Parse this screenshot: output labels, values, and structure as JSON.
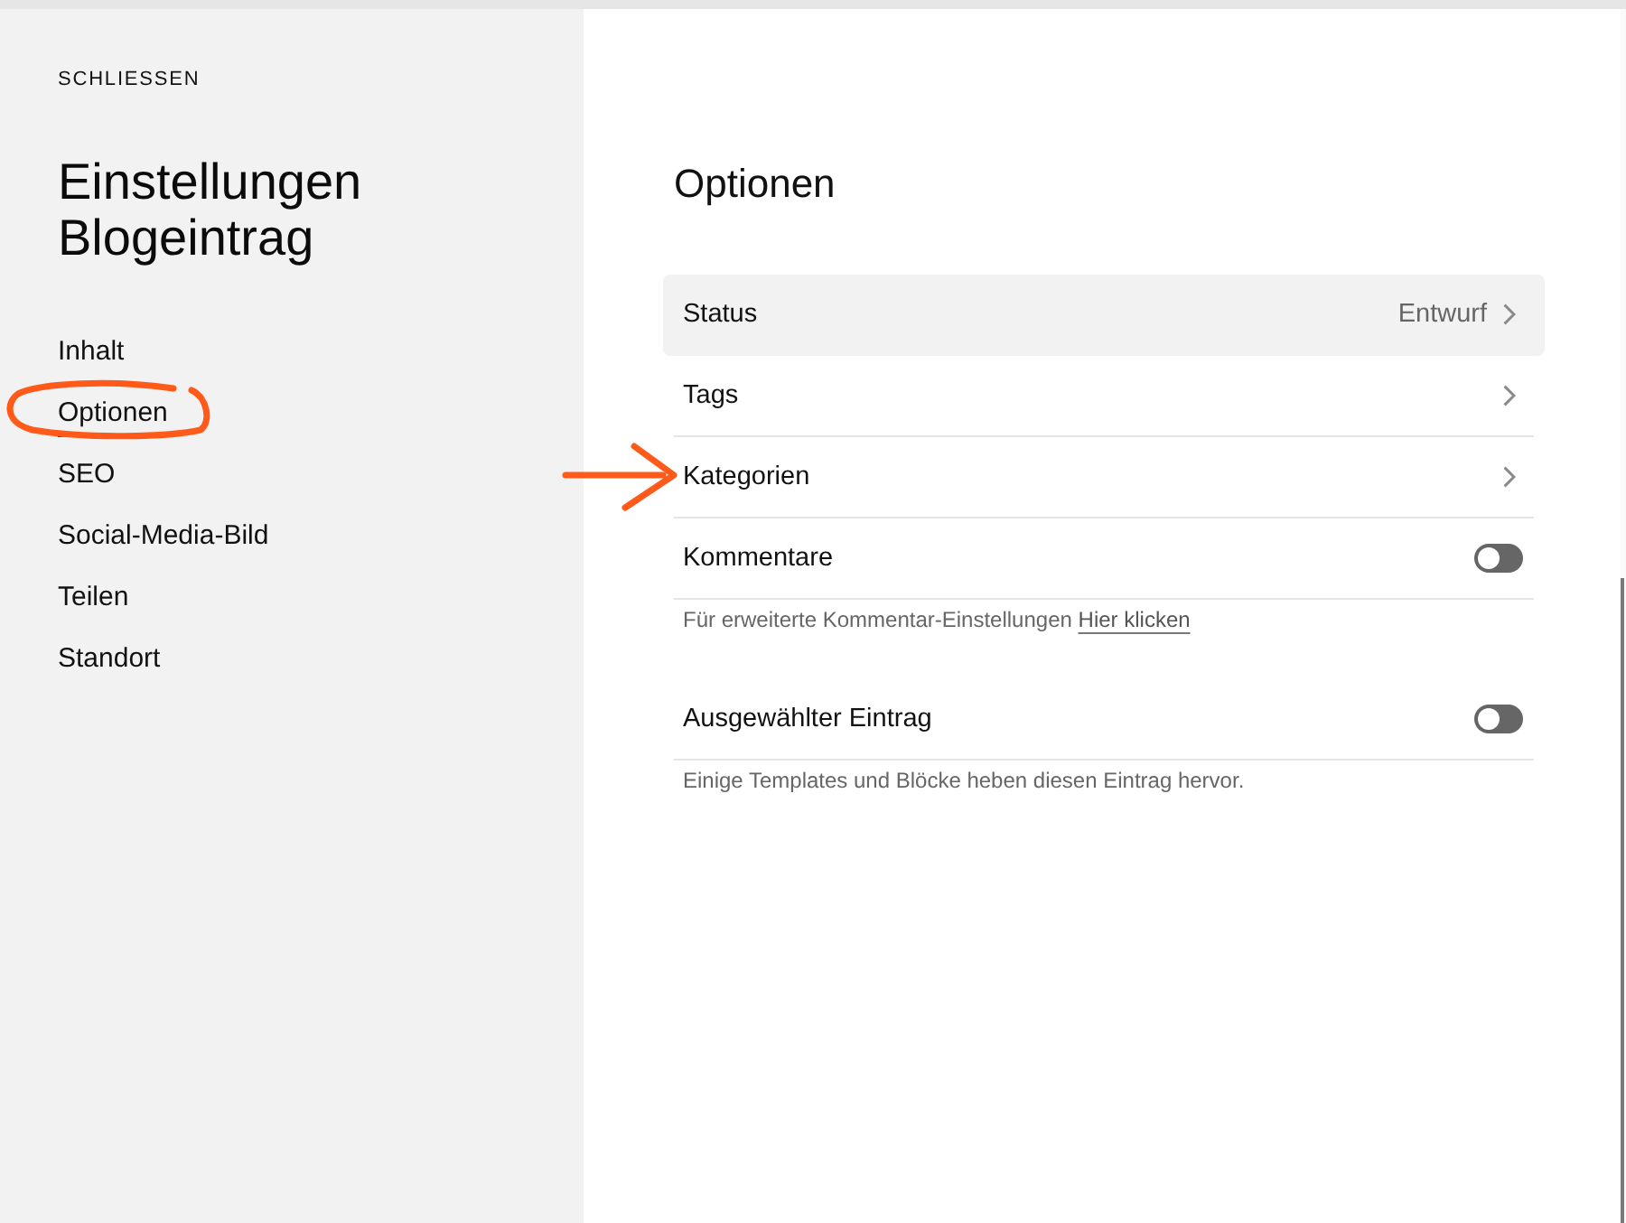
{
  "sidebar": {
    "close_label": "SCHLIESSEN",
    "title": "Einstellungen Blogeintrag",
    "items": [
      {
        "label": "Inhalt",
        "selected": false,
        "circled": false
      },
      {
        "label": "Optionen",
        "selected": true,
        "circled": true
      },
      {
        "label": "SEO",
        "selected": false,
        "circled": false
      },
      {
        "label": "Social-Media-Bild",
        "selected": false,
        "circled": false
      },
      {
        "label": "Teilen",
        "selected": false,
        "circled": false
      },
      {
        "label": "Standort",
        "selected": false,
        "circled": false
      }
    ]
  },
  "panel": {
    "title": "Optionen",
    "rows": [
      {
        "kind": "link",
        "label": "Status",
        "value": "Entwurf",
        "highlighted": true,
        "arrow_marked": false
      },
      {
        "kind": "link",
        "label": "Tags",
        "highlighted": false,
        "arrow_marked": false
      },
      {
        "kind": "link",
        "label": "Kategorien",
        "highlighted": false,
        "arrow_marked": true
      },
      {
        "kind": "toggle",
        "label": "Kommentare",
        "on": false,
        "hint": "Für erweiterte Kommentar-Einstellungen",
        "hint_link": "Hier klicken"
      },
      {
        "kind": "toggle",
        "label": "Ausgewählter Eintrag",
        "on": false,
        "hint": "Einige Templates und Blöcke heben diesen Eintrag hervor."
      }
    ]
  }
}
